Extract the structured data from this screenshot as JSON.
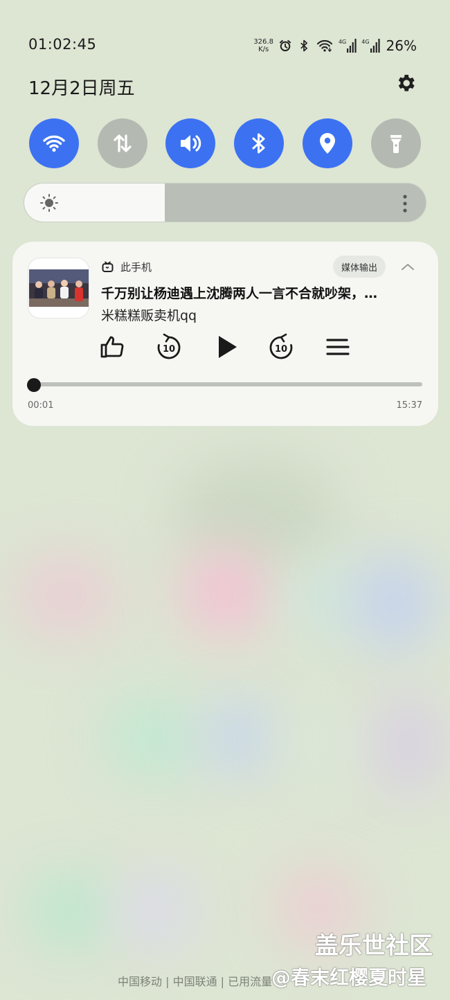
{
  "status_bar": {
    "time": "01:02:45",
    "net_speed_value": "326.8",
    "net_speed_unit": "K/s",
    "signal1_tag": "4G",
    "signal2_tag": "4G",
    "battery": "26%",
    "icons": [
      "alarm-icon",
      "bluetooth-icon",
      "wifi-icon",
      "signal-icon",
      "signal-icon"
    ]
  },
  "header": {
    "date": "12月2日周五",
    "settings_icon": "gear-icon"
  },
  "quick_tiles": [
    {
      "name": "wifi",
      "icon": "wifi-icon",
      "state": "on"
    },
    {
      "name": "mobile-data",
      "icon": "data-arrows-icon",
      "state": "off"
    },
    {
      "name": "sound",
      "icon": "speaker-icon",
      "state": "on"
    },
    {
      "name": "bluetooth",
      "icon": "bluetooth-icon",
      "state": "on"
    },
    {
      "name": "location",
      "icon": "location-pin-icon",
      "state": "on"
    },
    {
      "name": "flashlight",
      "icon": "flashlight-icon",
      "state": "off"
    }
  ],
  "brightness": {
    "level": 0.35,
    "icon": "sun-icon"
  },
  "media": {
    "source_label": "此手机",
    "output_button": "媒体输出",
    "title": "千万别让杨迪遇上沈腾两人一言不合就吵架，…",
    "artist": "米糕糕贩卖机qq",
    "elapsed": "00:01",
    "duration": "15:37",
    "progress": 0.001,
    "controls": [
      "thumbs-up-icon",
      "rewind-10-icon",
      "play-icon",
      "forward-10-icon",
      "queue-icon"
    ]
  },
  "footer": {
    "carrier_text": "中国移动 | 中国联通 | 已用流量",
    "watermark_line1": "盖乐世社区",
    "watermark_line2": "@春末红樱夏时星"
  },
  "colors": {
    "accent": "#3c72f1",
    "tile_off": "#b4bab1",
    "background": "#dde5d3",
    "card": "#f6f7f3"
  }
}
